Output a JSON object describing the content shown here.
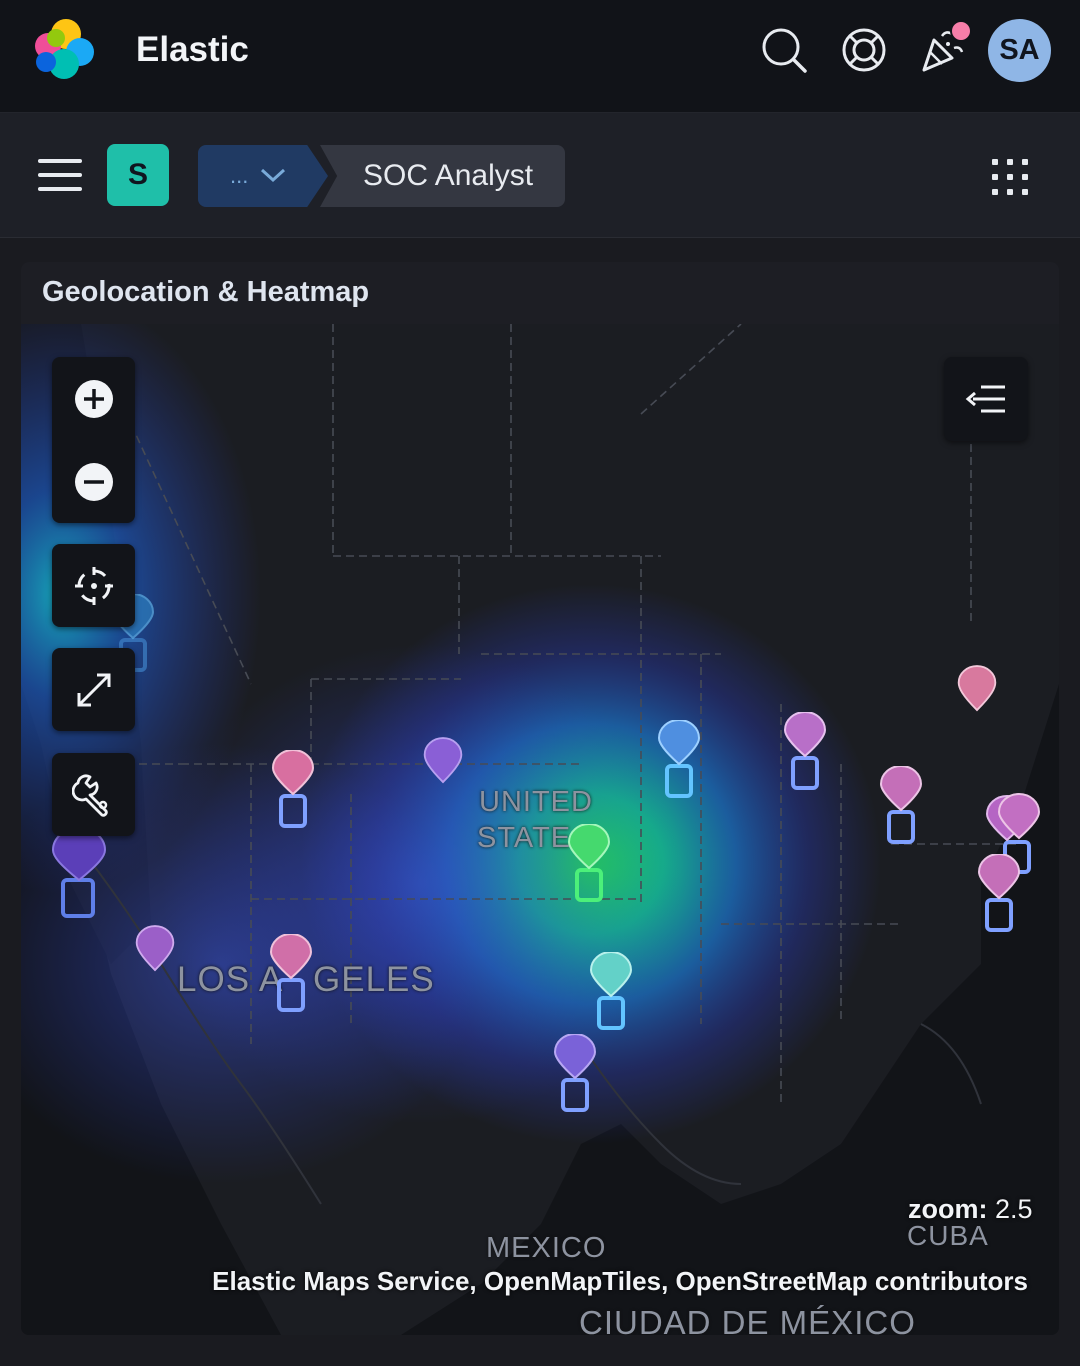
{
  "header": {
    "app_title": "Elastic",
    "avatar_initials": "SA",
    "icons": [
      "search-icon",
      "help-icon",
      "whats-new-icon"
    ]
  },
  "nav": {
    "space_initial": "S",
    "breadcrumb_root": "...",
    "breadcrumb_current": "SOC Analyst"
  },
  "panel": {
    "title": "Geolocation & Heatmap"
  },
  "map": {
    "labels": {
      "united": "UNITED",
      "states": "STATE",
      "los_angeles_1": "LOS A",
      "los_angeles_2": "GELES",
      "mexico": "MEXICO",
      "cuba": "CUBA",
      "ciudad": "CIUDAD DE MÉXICO"
    },
    "zoom_label": "zoom:",
    "zoom_value": "2.5",
    "attribution": "Elastic Maps Service, OpenMapTiles, OpenStreetMap contributors",
    "controls": [
      "zoom-in-icon",
      "zoom-out-icon",
      "locate-icon",
      "fullscreen-icon",
      "tools-icon",
      "legend-icon"
    ]
  },
  "colors": {
    "space_badge": "#1fbfa9",
    "avatar": "#8fb6e6",
    "pin_pink": "#d86fa0",
    "pin_purple": "#8a5fd6",
    "pin_teal": "#63d1c8",
    "heat_core": "#22e34f"
  }
}
